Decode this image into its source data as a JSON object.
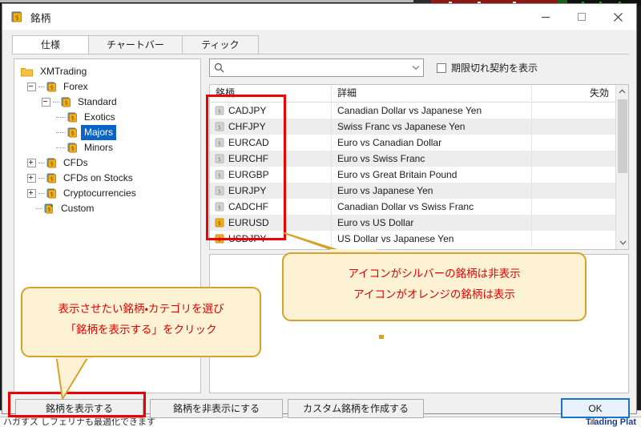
{
  "window": {
    "title": "銘柄",
    "icon": "symbol-book-icon",
    "controls": {
      "minimize": "minimize-icon",
      "maximize": "maximize-icon",
      "close": "close-icon"
    }
  },
  "tabs": [
    {
      "label": "仕様",
      "active": true
    },
    {
      "label": "チャートバー",
      "active": false
    },
    {
      "label": "ティック",
      "active": false
    }
  ],
  "tree": {
    "root": {
      "label": "XMTrading",
      "icon": "folder-icon"
    },
    "items": [
      {
        "label": "Forex",
        "depth": 1,
        "expander": "minus",
        "icon": "symbol-book-icon",
        "selected": false
      },
      {
        "label": "Standard",
        "depth": 2,
        "expander": "minus",
        "icon": "symbol-book-icon",
        "selected": false
      },
      {
        "label": "Exotics",
        "depth": 3,
        "expander": "none",
        "icon": "symbol-book-icon",
        "selected": false
      },
      {
        "label": "Majors",
        "depth": 3,
        "expander": "none",
        "icon": "symbol-book-icon",
        "selected": true
      },
      {
        "label": "Minors",
        "depth": 3,
        "expander": "none",
        "icon": "symbol-book-icon",
        "selected": false
      },
      {
        "label": "CFDs",
        "depth": 1,
        "expander": "plus",
        "icon": "symbol-book-icon",
        "selected": false
      },
      {
        "label": "CFDs on Stocks",
        "depth": 1,
        "expander": "plus",
        "icon": "symbol-book-icon",
        "selected": false
      },
      {
        "label": "Cryptocurrencies",
        "depth": 1,
        "expander": "plus",
        "icon": "symbol-book-icon",
        "selected": false
      },
      {
        "label": "Custom",
        "depth": 1,
        "expander": "none",
        "icon": "symbol-book-add-icon",
        "selected": false
      }
    ]
  },
  "search": {
    "value": "",
    "placeholder": "",
    "icon": "search-icon",
    "dropdown_icon": "chevron-down-icon"
  },
  "expired_checkbox": {
    "label": "期限切れ契約を表示",
    "checked": false
  },
  "table": {
    "columns": [
      "銘柄",
      "詳細",
      "失効"
    ],
    "rows": [
      {
        "symbol": "CADJPY",
        "description": "Canadian Dollar vs Japanese Yen",
        "expiry": "",
        "icon_color": "silver"
      },
      {
        "symbol": "CHFJPY",
        "description": "Swiss Franc vs Japanese Yen",
        "expiry": "",
        "icon_color": "silver"
      },
      {
        "symbol": "EURCAD",
        "description": "Euro vs Canadian Dollar",
        "expiry": "",
        "icon_color": "silver"
      },
      {
        "symbol": "EURCHF",
        "description": "Euro vs Swiss Franc",
        "expiry": "",
        "icon_color": "silver"
      },
      {
        "symbol": "EURGBP",
        "description": "Euro vs Great Britain Pound",
        "expiry": "",
        "icon_color": "silver"
      },
      {
        "symbol": "EURJPY",
        "description": "Euro vs Japanese Yen",
        "expiry": "",
        "icon_color": "silver"
      },
      {
        "symbol": "CADCHF",
        "description": "Canadian Dollar vs Swiss Franc",
        "expiry": "",
        "icon_color": "silver"
      },
      {
        "symbol": "EURUSD",
        "description": "Euro vs US Dollar",
        "expiry": "",
        "icon_color": "orange"
      },
      {
        "symbol": "USDJPY",
        "description": "US Dollar vs Japanese Yen",
        "expiry": "",
        "icon_color": "orange"
      }
    ],
    "scrollbar": {
      "up_icon": "chevron-up-icon",
      "down_icon": "chevron-down-icon"
    }
  },
  "buttons": {
    "show_symbol": "銘柄を表示する",
    "hide_symbol": "銘柄を非表示にする",
    "create_custom": "カスタム銘柄を作成する",
    "ok": "OK"
  },
  "callouts": {
    "left": {
      "line1": "表示させたい銘柄・カテゴリを選び",
      "line2": "「銘柄を表示する」をクリック"
    },
    "right": {
      "line1": "アイコンがシルバーの銘柄は非表示",
      "line2": "アイコンがオレンジの銘柄は表示"
    }
  },
  "background": {
    "status_left": "ハガすズ しフェリナも最適化できます",
    "status_right": "Trading Plat"
  },
  "colors": {
    "accent_blue": "#0a64c8",
    "highlight_red": "#ee0000",
    "callout_fill": "#fdf3d4",
    "callout_border": "#d6a22a",
    "callout_text": "#e00000",
    "icon_orange": "#f2b01e",
    "icon_silver": "#c9c9c9",
    "ok_border": "#1675c8"
  }
}
